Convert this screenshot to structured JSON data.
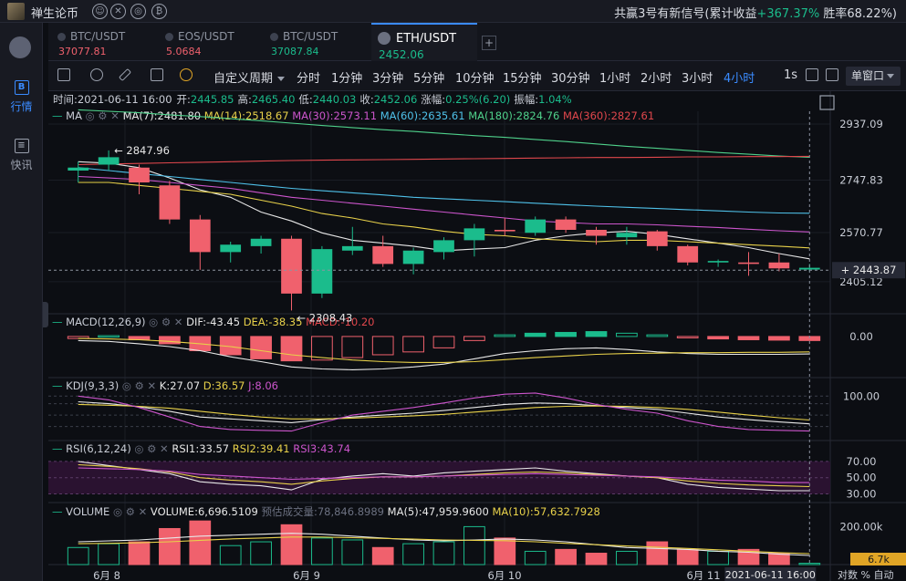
{
  "topbar": {
    "app_name": "禅生论币",
    "signal_prefix": "共赢3号有新信号(累计收益",
    "signal_value": "+367.37%",
    "signal_suffix": " 胜率68.22%)"
  },
  "sidebar": {
    "items": [
      {
        "label": "行情",
        "icon": "B",
        "active": true
      },
      {
        "label": "快讯",
        "icon": "≡",
        "active": false
      }
    ]
  },
  "tabs": [
    {
      "name": "BTC/USDT",
      "price": "37077.81",
      "color": "red"
    },
    {
      "name": "EOS/USDT",
      "price": "5.0684",
      "color": "red"
    },
    {
      "name": "BTC/USDT",
      "price": "37087.84",
      "color": "green"
    },
    {
      "name": "ETH/USDT",
      "price": "2452.06",
      "color": "green",
      "active": true
    }
  ],
  "toolbar": {
    "custom_period": "自定义周期",
    "periods": [
      "分时",
      "1分钟",
      "3分钟",
      "5分钟",
      "10分钟",
      "15分钟",
      "30分钟",
      "1小时",
      "2小时",
      "3小时",
      "4小时"
    ],
    "active_period": "4小时",
    "interval_1s": "1s",
    "window_mode": "单窗口"
  },
  "info": {
    "time_label": "时间:",
    "time": "2021-06-11 16:00",
    "open_label": "开:",
    "open": "2445.85",
    "high_label": "高:",
    "high": "2465.40",
    "low_label": "低:",
    "low": "2440.03",
    "close_label": "收:",
    "close": "2452.06",
    "change_label": "涨幅:",
    "change": "0.25%(6.20)",
    "amplitude_label": "振幅:",
    "amplitude": "1.04%"
  },
  "legends": {
    "ma": {
      "name": "MA",
      "items": [
        {
          "text": "MA(7):2481.80",
          "color": "#e8e8e8"
        },
        {
          "text": "MA(14):2518.67",
          "color": "#e8d14a"
        },
        {
          "text": "MA(30):2573.11",
          "color": "#cc55cc"
        },
        {
          "text": "MA(60):2635.61",
          "color": "#4fc1e9"
        },
        {
          "text": "MA(180):2824.76",
          "color": "#4fd18b"
        },
        {
          "text": "MA(360):2827.61",
          "color": "#e0474c"
        }
      ]
    },
    "macd": {
      "name": "MACD(12,26,9)",
      "items": [
        {
          "text": "DIF:-43.45",
          "color": "#e8e8e8"
        },
        {
          "text": "DEA:-38.35",
          "color": "#e8d14a"
        },
        {
          "text": "MACD:-10.20",
          "color": "#e0474c"
        }
      ]
    },
    "kdj": {
      "name": "KDJ(9,3,3)",
      "items": [
        {
          "text": "K:27.07",
          "color": "#e8e8e8"
        },
        {
          "text": "D:36.57",
          "color": "#e8d14a"
        },
        {
          "text": "J:8.06",
          "color": "#cc55cc"
        }
      ]
    },
    "rsi": {
      "name": "RSI(6,12,24)",
      "items": [
        {
          "text": "RSI1:33.57",
          "color": "#e8e8e8"
        },
        {
          "text": "RSI2:39.41",
          "color": "#e8d14a"
        },
        {
          "text": "RSI3:43.74",
          "color": "#cc55cc"
        }
      ]
    },
    "volume": {
      "name": "VOLUME",
      "items": [
        {
          "text": "VOLUME:6,696.5109",
          "color": "#e8e8e8"
        },
        {
          "text": "预估成交量:78,846.8989",
          "color": "#6b7080"
        },
        {
          "text": "MA(5):47,959.9600",
          "color": "#e8e8e8"
        },
        {
          "text": "MA(10):57,632.7928",
          "color": "#e8d14a"
        }
      ]
    }
  },
  "price_axis": {
    "ticks": [
      "2937.09",
      "2747.83",
      "2570.77",
      "2405.12"
    ],
    "current_price": "2443.87"
  },
  "macd_axis": {
    "ticks": [
      "0.00"
    ]
  },
  "kdj_axis": {
    "ticks": [
      "100.00"
    ]
  },
  "rsi_axis": {
    "ticks": [
      "70.00",
      "50.00",
      "30.00"
    ]
  },
  "volume_axis": {
    "ticks": [
      "200.00k"
    ],
    "current": "6.7k"
  },
  "time_axis": {
    "labels": [
      "6月 8",
      "6月 9",
      "6月 10",
      "6月 11"
    ],
    "cursor": "2021-06-11 16:00",
    "right_labels": [
      "对数",
      "%",
      "自动"
    ]
  },
  "chart_data": {
    "type": "candlestick",
    "symbol": "ETH/USDT",
    "interval": "4小时",
    "high_annotation": "2847.96",
    "low_annotation": "2308.43",
    "ylim": [
      2300,
      2980
    ],
    "candles": [
      {
        "o": 2780,
        "h": 2810,
        "l": 2740,
        "c": 2790
      },
      {
        "o": 2800,
        "h": 2848,
        "l": 2780,
        "c": 2825
      },
      {
        "o": 2790,
        "h": 2800,
        "l": 2700,
        "c": 2740
      },
      {
        "o": 2730,
        "h": 2745,
        "l": 2600,
        "c": 2615
      },
      {
        "o": 2615,
        "h": 2630,
        "l": 2445,
        "c": 2505
      },
      {
        "o": 2505,
        "h": 2540,
        "l": 2470,
        "c": 2530
      },
      {
        "o": 2525,
        "h": 2560,
        "l": 2500,
        "c": 2550
      },
      {
        "o": 2550,
        "h": 2560,
        "l": 2308,
        "c": 2365
      },
      {
        "o": 2365,
        "h": 2525,
        "l": 2350,
        "c": 2515
      },
      {
        "o": 2510,
        "h": 2590,
        "l": 2495,
        "c": 2525
      },
      {
        "o": 2525,
        "h": 2560,
        "l": 2455,
        "c": 2465
      },
      {
        "o": 2465,
        "h": 2520,
        "l": 2430,
        "c": 2510
      },
      {
        "o": 2505,
        "h": 2555,
        "l": 2480,
        "c": 2545
      },
      {
        "o": 2545,
        "h": 2600,
        "l": 2490,
        "c": 2585
      },
      {
        "o": 2580,
        "h": 2620,
        "l": 2560,
        "c": 2575
      },
      {
        "o": 2570,
        "h": 2625,
        "l": 2560,
        "c": 2615
      },
      {
        "o": 2615,
        "h": 2625,
        "l": 2570,
        "c": 2580
      },
      {
        "o": 2580,
        "h": 2590,
        "l": 2530,
        "c": 2560
      },
      {
        "o": 2555,
        "h": 2590,
        "l": 2530,
        "c": 2570
      },
      {
        "o": 2575,
        "h": 2580,
        "l": 2510,
        "c": 2525
      },
      {
        "o": 2525,
        "h": 2530,
        "l": 2460,
        "c": 2470
      },
      {
        "o": 2470,
        "h": 2480,
        "l": 2455,
        "c": 2475
      },
      {
        "o": 2470,
        "h": 2505,
        "l": 2425,
        "c": 2465
      },
      {
        "o": 2470,
        "h": 2500,
        "l": 2440,
        "c": 2450
      },
      {
        "o": 2446,
        "h": 2465,
        "l": 2440,
        "c": 2452
      }
    ],
    "ma": {
      "MA(7)": [
        2810,
        2805,
        2790,
        2755,
        2715,
        2690,
        2640,
        2610,
        2570,
        2545,
        2535,
        2525,
        2510,
        2515,
        2520,
        2545,
        2560,
        2570,
        2575,
        2565,
        2550,
        2535,
        2520,
        2500,
        2482
      ],
      "MA(14)": [
        2740,
        2740,
        2730,
        2720,
        2710,
        2700,
        2680,
        2660,
        2635,
        2620,
        2600,
        2590,
        2575,
        2565,
        2560,
        2550,
        2545,
        2540,
        2545,
        2545,
        2540,
        2535,
        2530,
        2525,
        2519
      ],
      "MA(30)": [
        2760,
        2755,
        2750,
        2740,
        2730,
        2720,
        2705,
        2690,
        2680,
        2670,
        2660,
        2650,
        2640,
        2630,
        2620,
        2610,
        2605,
        2600,
        2600,
        2597,
        2592,
        2588,
        2582,
        2577,
        2573
      ],
      "MA(60)": [
        2790,
        2780,
        2770,
        2760,
        2750,
        2740,
        2730,
        2720,
        2712,
        2705,
        2698,
        2690,
        2685,
        2680,
        2675,
        2670,
        2665,
        2660,
        2656,
        2652,
        2648,
        2644,
        2640,
        2637,
        2636
      ],
      "MA(180)": [
        2985,
        2980,
        2975,
        2968,
        2962,
        2955,
        2948,
        2940,
        2932,
        2925,
        2918,
        2912,
        2905,
        2898,
        2892,
        2885,
        2878,
        2870,
        2862,
        2855,
        2848,
        2841,
        2835,
        2829,
        2825
      ],
      "MA(360)": [
        2800,
        2802,
        2804,
        2806,
        2808,
        2810,
        2812,
        2814,
        2815,
        2816,
        2817,
        2818,
        2819,
        2820,
        2821,
        2822,
        2823,
        2824,
        2824,
        2825,
        2826,
        2826,
        2827,
        2827,
        2828
      ]
    },
    "macd": {
      "hist": [
        -5,
        2,
        -8,
        -18,
        -35,
        -45,
        -55,
        -60,
        -58,
        -52,
        -45,
        -38,
        -28,
        -10,
        4,
        8,
        10,
        12,
        8,
        4,
        -2,
        -6,
        -8,
        -9,
        -10
      ],
      "dif": [
        -10,
        -12,
        -18,
        -25,
        -35,
        -50,
        -62,
        -75,
        -80,
        -82,
        -80,
        -75,
        -68,
        -55,
        -42,
        -35,
        -30,
        -28,
        -32,
        -38,
        -42,
        -44,
        -44,
        -44,
        -43
      ],
      "dea": [
        -5,
        -6,
        -8,
        -12,
        -18,
        -25,
        -35,
        -45,
        -52,
        -58,
        -62,
        -64,
        -64,
        -62,
        -57,
        -52,
        -48,
        -44,
        -42,
        -41,
        -40,
        -40,
        -39,
        -39,
        -38
      ]
    },
    "kdj": {
      "k": [
        85,
        80,
        72,
        60,
        45,
        40,
        35,
        30,
        38,
        45,
        50,
        55,
        62,
        70,
        78,
        82,
        80,
        75,
        70,
        65,
        55,
        45,
        38,
        32,
        27
      ],
      "d": [
        78,
        76,
        73,
        68,
        60,
        52,
        45,
        40,
        40,
        42,
        45,
        48,
        52,
        58,
        64,
        70,
        73,
        74,
        73,
        70,
        65,
        58,
        50,
        43,
        37
      ],
      "j": [
        100,
        90,
        70,
        45,
        20,
        12,
        10,
        8,
        30,
        50,
        60,
        70,
        82,
        95,
        105,
        108,
        95,
        78,
        65,
        55,
        35,
        20,
        12,
        10,
        8
      ]
    },
    "rsi": {
      "rsi1": [
        70,
        65,
        60,
        55,
        45,
        42,
        40,
        35,
        48,
        52,
        55,
        52,
        56,
        58,
        60,
        62,
        58,
        55,
        52,
        50,
        42,
        38,
        36,
        34,
        34
      ],
      "rsi2": [
        66,
        64,
        61,
        57,
        50,
        47,
        45,
        42,
        46,
        49,
        51,
        51,
        52,
        54,
        56,
        57,
        56,
        54,
        52,
        50,
        46,
        43,
        41,
        40,
        39
      ],
      "rsi3": [
        62,
        61,
        60,
        58,
        54,
        52,
        50,
        48,
        49,
        50,
        51,
        51,
        52,
        53,
        54,
        55,
        54,
        53,
        52,
        51,
        49,
        47,
        46,
        44,
        44
      ]
    },
    "volume": {
      "values": [
        90000,
        110000,
        120000,
        190000,
        230000,
        100000,
        120000,
        210000,
        140000,
        130000,
        90000,
        110000,
        120000,
        200000,
        140000,
        70000,
        80000,
        60000,
        70000,
        120000,
        80000,
        70000,
        80000,
        60000,
        6700
      ],
      "ma5": [
        120000,
        125000,
        130000,
        140000,
        150000,
        155000,
        160000,
        165000,
        160000,
        150000,
        140000,
        130000,
        125000,
        130000,
        135000,
        130000,
        120000,
        105000,
        90000,
        85000,
        80000,
        70000,
        65000,
        55000,
        48000
      ],
      "ma10": [
        110000,
        112000,
        115000,
        120000,
        128000,
        135000,
        140000,
        145000,
        145000,
        142000,
        138000,
        134000,
        130000,
        128000,
        126000,
        120000,
        112000,
        105000,
        98000,
        92000,
        85000,
        78000,
        70000,
        63000,
        57600
      ]
    }
  }
}
